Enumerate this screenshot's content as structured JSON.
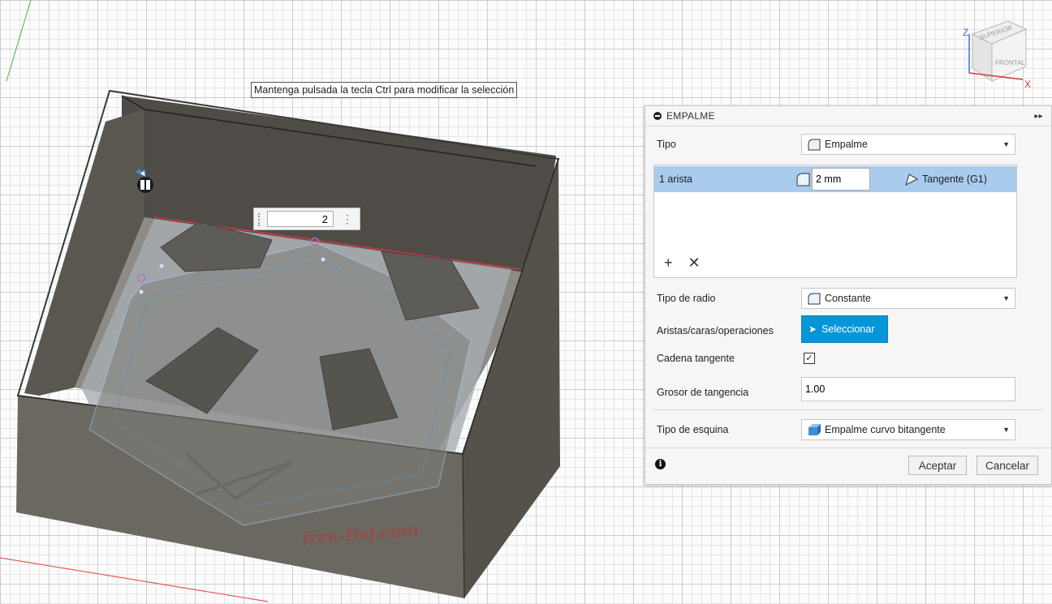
{
  "viewport": {
    "tooltip": "Mantenga pulsada la tecla Ctrl para modificar la selección",
    "radius_input_value": "2",
    "watermark": "free-Dxf.com",
    "viewcube": {
      "top_label": "SUPERIOR",
      "front_label": "FRONTAL",
      "axis_z": "Z",
      "axis_x": "X"
    }
  },
  "panel": {
    "title": "EMPALME",
    "tipo": {
      "label": "Tipo",
      "value": "Empalme"
    },
    "edges": [
      {
        "name": "1 arista",
        "radius": "2 mm",
        "continuity": "Tangente (G1)"
      }
    ],
    "tipo_radio": {
      "label": "Tipo de radio",
      "value": "Constante"
    },
    "aristas": {
      "label": "Aristas/caras/operaciones",
      "button": "Seleccionar"
    },
    "cadena": {
      "label": "Cadena tangente",
      "checked": true,
      "mark": "✓"
    },
    "grosor": {
      "label": "Grosor de tangencia",
      "value": "1.00"
    },
    "esquina": {
      "label": "Tipo de esquina",
      "value": "Empalme curvo bitangente"
    },
    "ok": "Aceptar",
    "cancel": "Cancelar"
  },
  "colors": {
    "accent": "#0696d7",
    "selection_row": "#a9cbee",
    "model": "#6b6861"
  }
}
